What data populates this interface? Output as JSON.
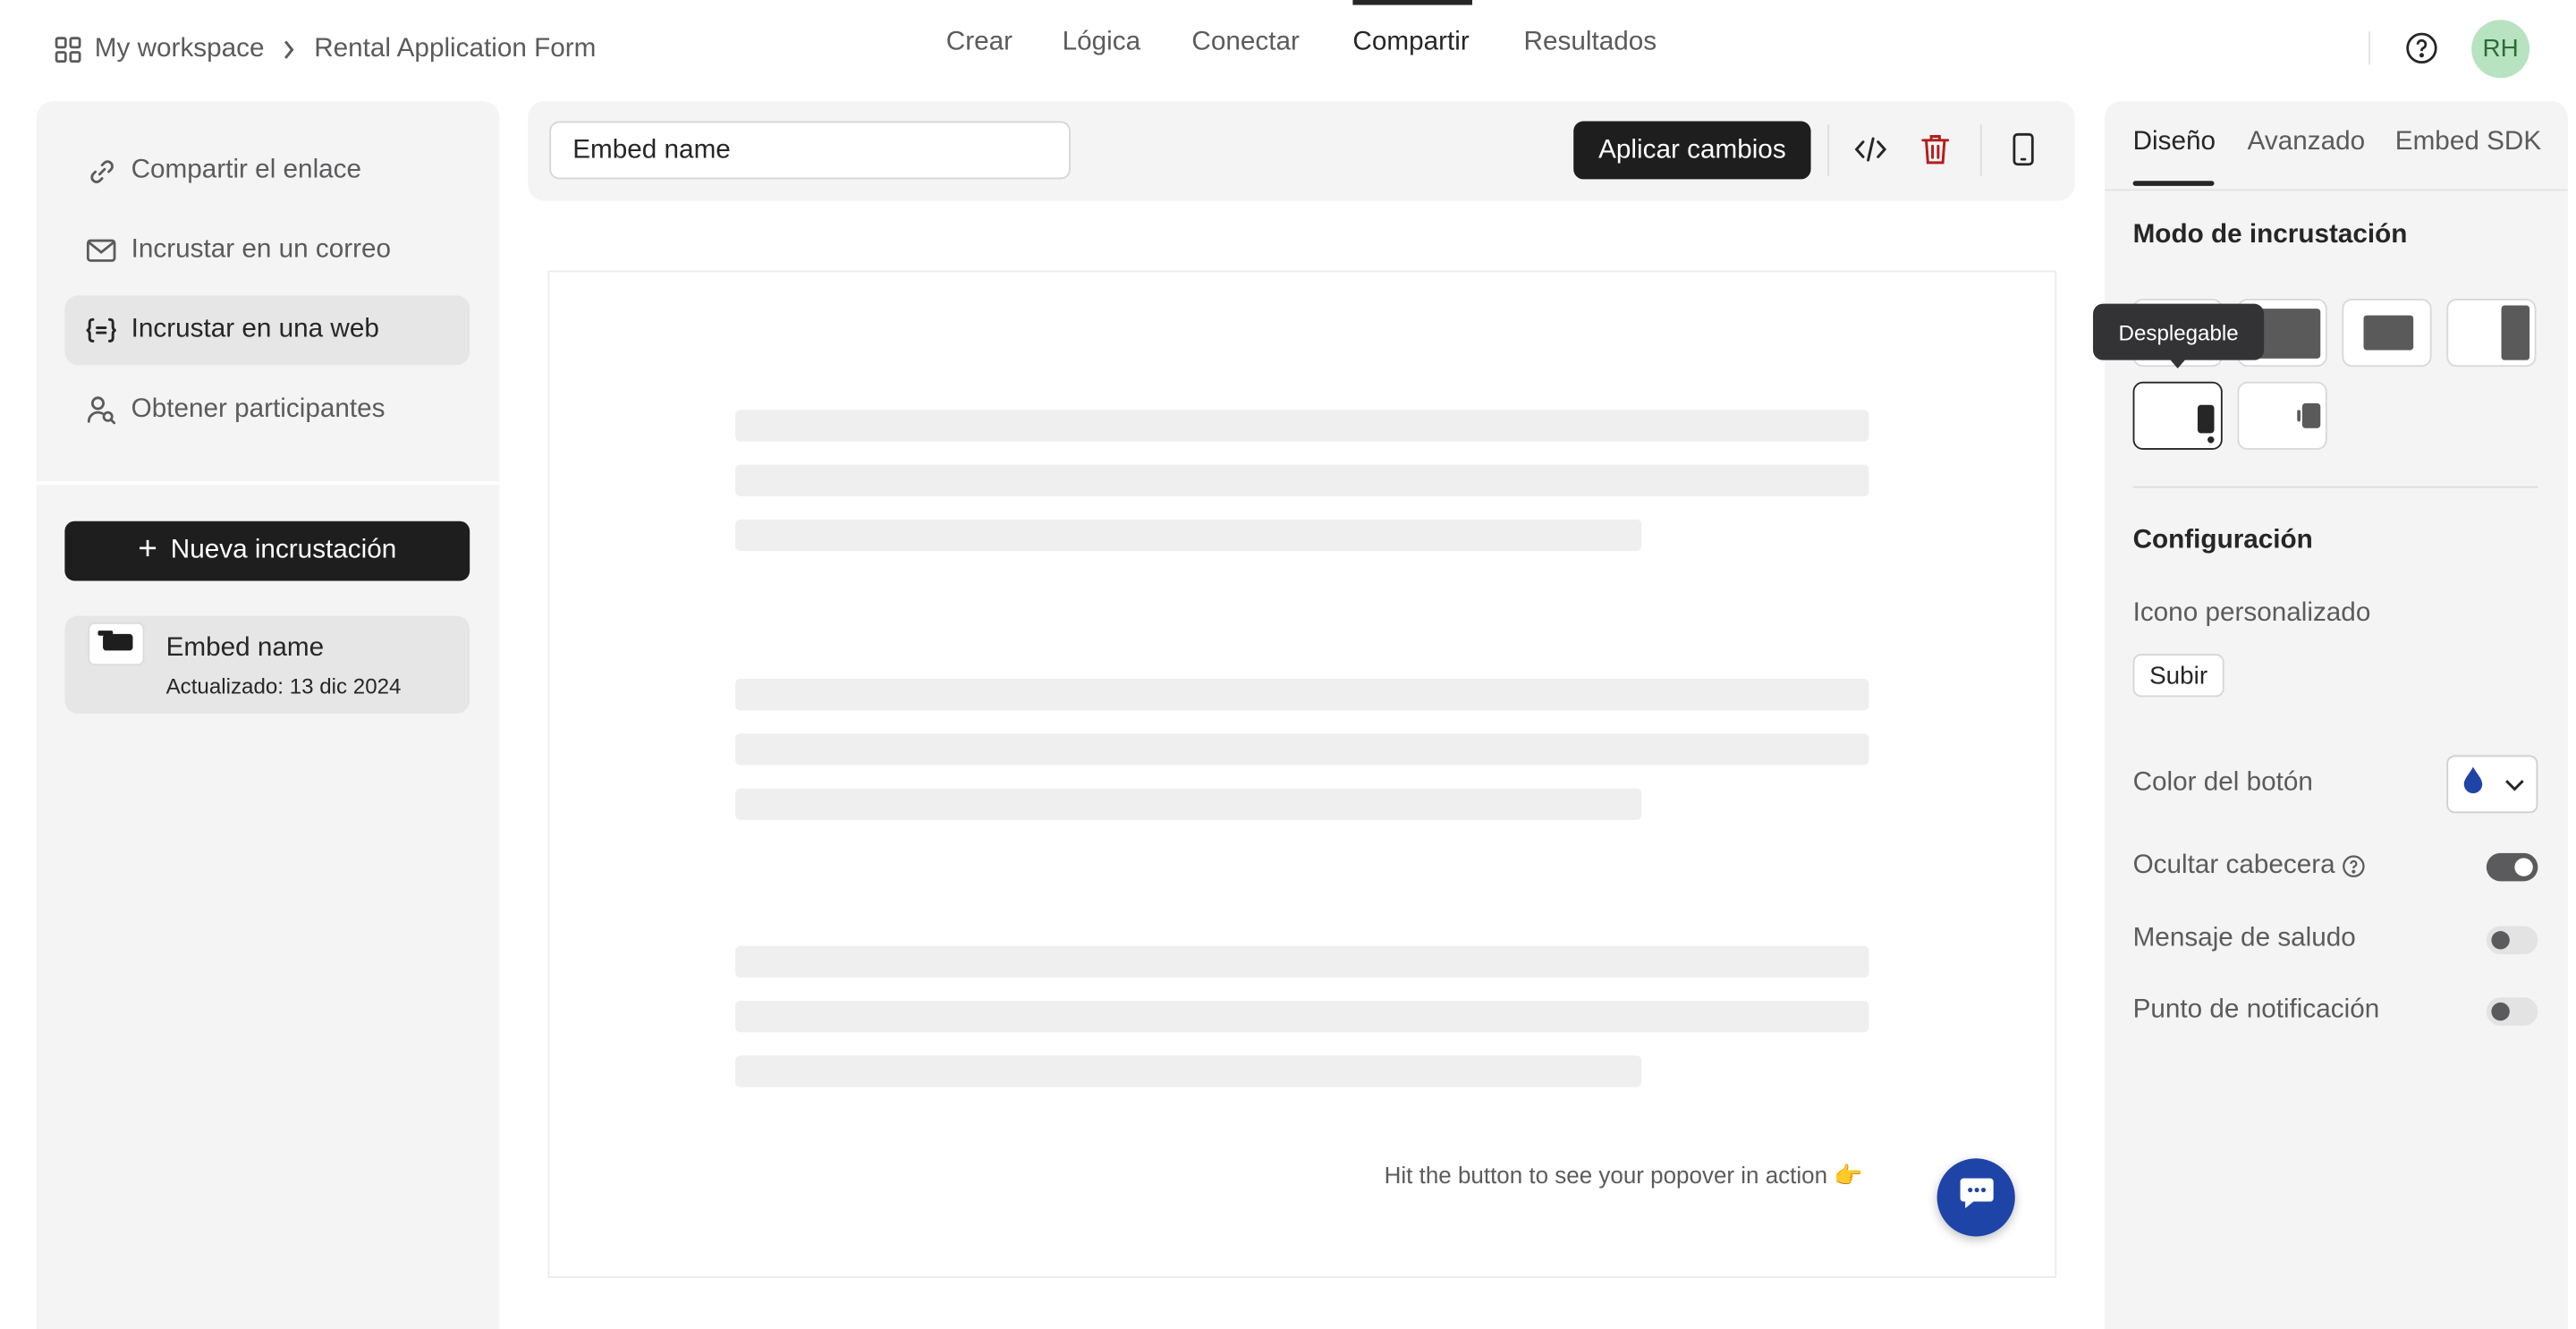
{
  "header": {
    "workspace": "My workspace",
    "form_name": "Rental Application Form",
    "nav": [
      "Crear",
      "Lógica",
      "Conectar",
      "Compartir",
      "Resultados"
    ],
    "active_nav": "Compartir",
    "avatar_initials": "RH"
  },
  "sidebar": {
    "items": [
      {
        "label": "Compartir el enlace",
        "icon": "link-icon"
      },
      {
        "label": "Incrustar en un correo",
        "icon": "mail-icon"
      },
      {
        "label": "Incrustar en una web",
        "icon": "code-brackets-icon"
      },
      {
        "label": "Obtener participantes",
        "icon": "user-search-icon"
      }
    ],
    "active_item": "Incrustar en una web",
    "new_button": "Nueva incrustación",
    "embed": {
      "title": "Embed name",
      "updated": "Actualizado: 13 dic 2024"
    }
  },
  "toolbar": {
    "name_value": "Embed name",
    "apply_label": "Aplicar cambios"
  },
  "preview": {
    "hint": "Hit the button to see your popover in action 👉"
  },
  "panel": {
    "tabs": [
      "Diseño",
      "Avanzado",
      "Embed SDK"
    ],
    "active_tab": "Diseño",
    "mode_title": "Modo de incrustación",
    "tooltip": "Desplegable",
    "config_title": "Configuración",
    "custom_icon_label": "Icono personalizado",
    "upload_label": "Subir",
    "button_color_label": "Color del botón",
    "button_color": "#1f44a8",
    "hide_header_label": "Ocultar cabecera",
    "hide_header_on": true,
    "greeting_label": "Mensaje de saludo",
    "greeting_on": false,
    "notification_label": "Punto de notificación",
    "notification_on": false
  }
}
